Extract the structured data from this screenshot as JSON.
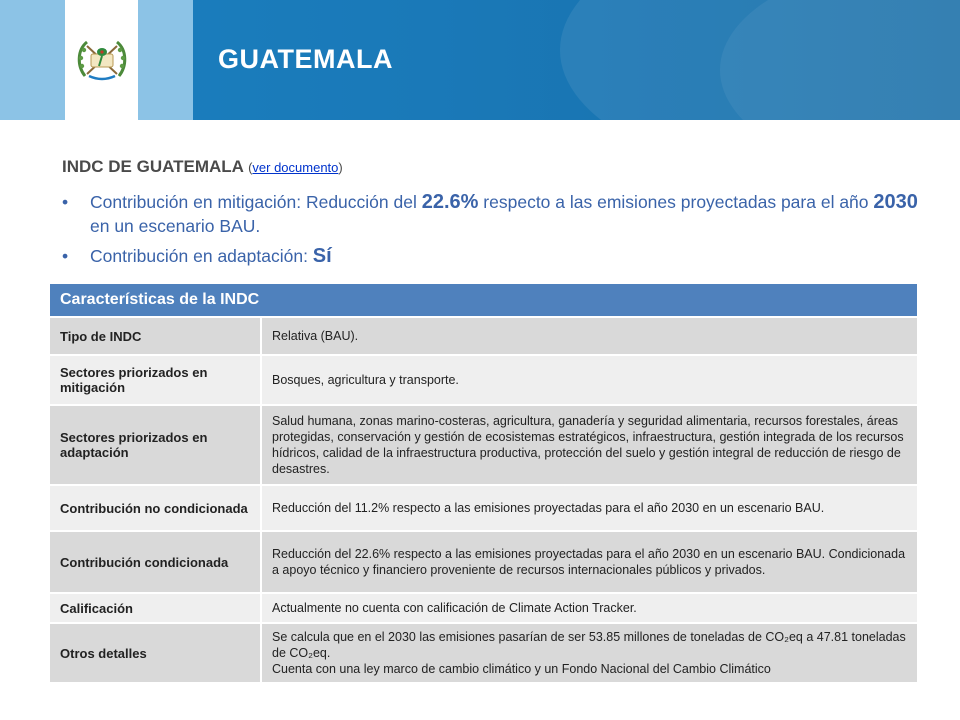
{
  "header": {
    "title": "GUATEMALA",
    "colors": {
      "banner": "#1b7fbf",
      "flag_blue": "#8cc3e6",
      "flag_white": "#ffffff"
    },
    "coat_icon": "guatemala-coat-of-arms-icon"
  },
  "intro": {
    "title": "INDC DE GUATEMALA",
    "paren_open": "(",
    "link_label": "ver documento",
    "paren_close": ")",
    "bullets": [
      {
        "pre": "Contribución en mitigación: Reducción del ",
        "highlight1": "22.6%",
        "mid": " respecto a las emisiones proyectadas para el año ",
        "highlight2": "2030",
        "post": " en un escenario BAU."
      },
      {
        "pre": "Contribución en adaptación: ",
        "highlight1": "Sí"
      }
    ],
    "bullet_char": "•",
    "text_color": "#3a63a9"
  },
  "table": {
    "header": "Características de la INDC",
    "header_color": "#4f81bd",
    "rows": [
      {
        "label": "Tipo de INDC",
        "value": "Relativa (BAU)."
      },
      {
        "label": "Sectores priorizados en mitigación",
        "value": "Bosques, agricultura y transporte."
      },
      {
        "label": "Sectores priorizados en adaptación",
        "value": "Salud humana, zonas marino-costeras, agricultura, ganadería y seguridad alimentaria, recursos forestales, áreas protegidas, conservación y gestión de ecosistemas estratégicos, infraestructura, gestión integrada de los recursos hídricos, calidad de la infraestructura productiva, protección del suelo y gestión  integral de reducción de riesgo de desastres."
      },
      {
        "label": "Contribución no condicionada",
        "value": "Reducción del 11.2% respecto a las emisiones proyectadas para el año 2030 en un escenario BAU."
      },
      {
        "label": "Contribución condicionada",
        "value": "Reducción del 22.6% respecto a las emisiones proyectadas para el año 2030 en un escenario BAU. Condicionada a apoyo técnico y financiero proveniente de recursos internacionales públicos y privados."
      },
      {
        "label": "Calificación",
        "value": "Actualmente no cuenta con calificación de Climate Action Tracker."
      },
      {
        "label": "Otros detalles",
        "value_line1": "Se calcula que en el 2030 las emisiones pasarían de ser 53.85 millones de toneladas de CO₂eq a 47.81 toneladas de CO₂eq.",
        "value_line2": "Cuenta con una ley marco de cambio climático y un Fondo Nacional del Cambio Climático"
      }
    ]
  }
}
